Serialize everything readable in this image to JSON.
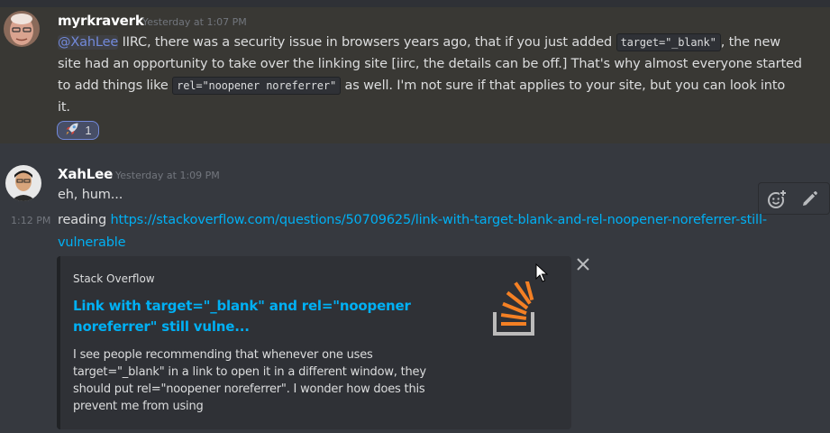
{
  "messages": [
    {
      "author": "myrkraverk",
      "timestamp": "Yesterday at 1:07 PM",
      "text": {
        "mention": "@XahLee",
        "part1": " IIRC, there was a security issue in browsers years ago, that if you just added ",
        "code1": "target=\"_blank\"",
        "part2": ", the new",
        "line2": "site had an opportunity to take over the linking site [iirc, the details can be off.]  That's why almost everyone started",
        "line3_pre": "to add things like ",
        "code2": "rel=\"noopener noreferrer\"",
        "line3_post": " as well.  I'm not sure if that applies to your site, but you can look into",
        "line4": "it."
      },
      "reaction": {
        "emoji": "rocket",
        "count": "1"
      }
    },
    {
      "author": "XahLee",
      "timestamp": "Yesterday at 1:09 PM",
      "text": "eh, hum..."
    },
    {
      "side_timestamp": "1:12 PM",
      "text_prefix": "reading ",
      "link_line1": "https://stackoverflow.com/questions/50709625/link-with-target-blank-and-rel-noopener-noreferrer-still-",
      "link_line2": "vulnerable",
      "embed": {
        "provider": "Stack Overflow",
        "title": "Link with target=\"_blank\" and rel=\"noopener noreferrer\" still vulne...",
        "description": "I see people recommending that whenever one uses target=\"_blank\" in a link to open it in a different window, they should put rel=\"noopener noreferrer\". I wonder how does this prevent me from using",
        "thumbnail_icon": "stackoverflow-logo-icon"
      }
    }
  ],
  "toolbar": {
    "icons": [
      "add-reaction-icon",
      "edit-pencil-icon"
    ]
  },
  "colors": {
    "background": "#36393f",
    "highlighted_message": "#393834",
    "mention": "#7289da",
    "link": "#00b0f4",
    "embed_bg": "#2f3136",
    "stackoverflow_orange": "#f48024"
  }
}
